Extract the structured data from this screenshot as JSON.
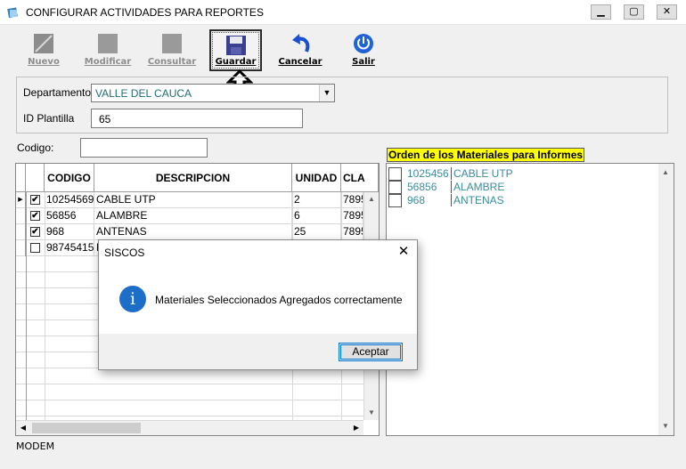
{
  "window": {
    "title": "CONFIGURAR ACTIVIDADES PARA REPORTES",
    "min_glyph": "▁",
    "max_glyph": "▢",
    "close_glyph": "✕"
  },
  "toolbar": {
    "nuevo": "Nuevo",
    "modificar": "Modificar",
    "consultar": "Consultar",
    "guardar": "Guardar",
    "cancelar": "Cancelar",
    "salir": "Salir"
  },
  "form": {
    "departamento_label": "Departamento",
    "departamento_value": "VALLE DEL CAUCA",
    "id_plantilla_label": "ID Plantilla",
    "id_plantilla_value": "65",
    "codigo_label": "Codigo:",
    "codigo_value": ""
  },
  "grid": {
    "columns": [
      "CODIGO",
      "DESCRIPCION",
      "UNIDAD",
      "CLA"
    ],
    "rows": [
      {
        "checked": true,
        "current": true,
        "codigo": "10254569",
        "descripcion": "CABLE UTP",
        "unidad": "2",
        "cla": "7895"
      },
      {
        "checked": true,
        "current": false,
        "codigo": "56856",
        "descripcion": "ALAMBRE",
        "unidad": "6",
        "cla": "7895"
      },
      {
        "checked": true,
        "current": false,
        "codigo": "968",
        "descripcion": "ANTENAS",
        "unidad": "25",
        "cla": "7895"
      },
      {
        "checked": false,
        "current": false,
        "codigo": "98745415",
        "descripcion": "M",
        "unidad": "",
        "cla": ""
      }
    ]
  },
  "orden": {
    "title": "Orden de los Materiales para Informes",
    "items": [
      {
        "codigo": "1025456",
        "descripcion": "CABLE UTP"
      },
      {
        "codigo": "56856",
        "descripcion": "ALAMBRE"
      },
      {
        "codigo": "968",
        "descripcion": "ANTENAS"
      }
    ]
  },
  "status": {
    "text": "MODEM"
  },
  "dialog": {
    "title": "SISCOS",
    "message": "Materiales Seleccionados Agregados correctamente",
    "ok_label": "Aceptar",
    "close_glyph": "✕",
    "icon_glyph": "i"
  },
  "colors": {
    "accent": "#0078d7",
    "highlight": "#ffff00",
    "list_text": "#3b8b9b",
    "info_icon": "#1d6ec9"
  }
}
